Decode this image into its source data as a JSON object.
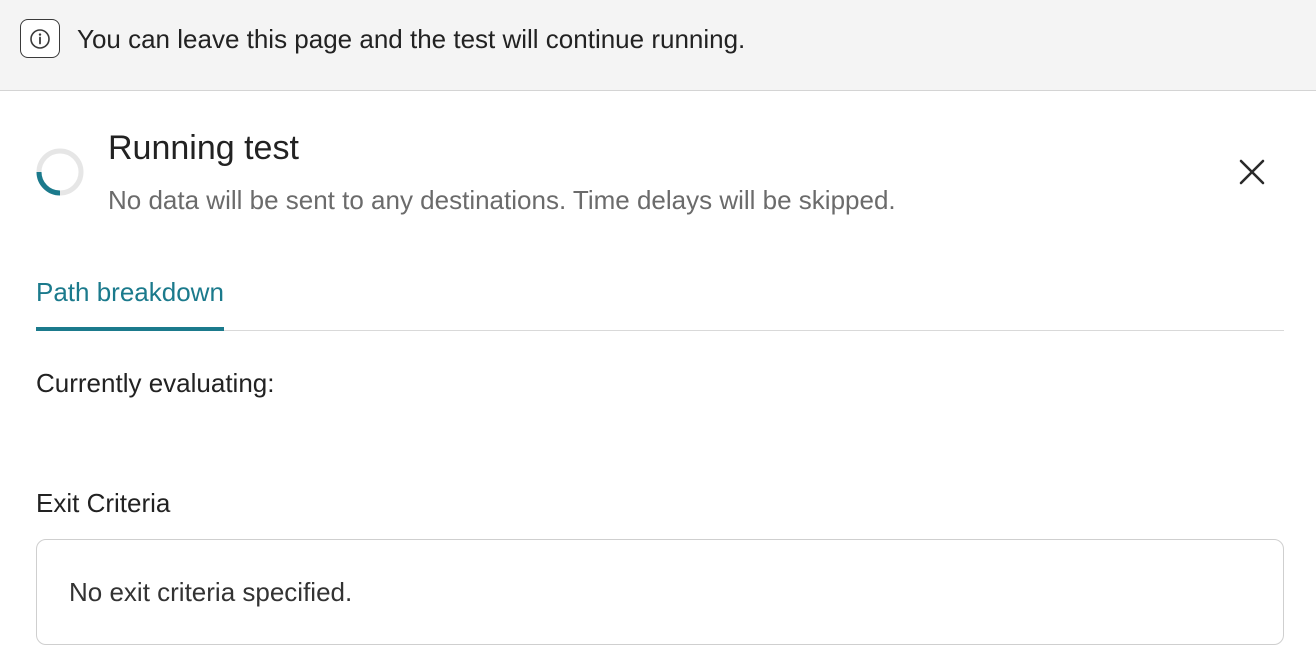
{
  "banner": {
    "icon": "info-icon",
    "text": "You can leave this page and the test will continue running."
  },
  "header": {
    "status_icon": "loading-spinner-icon",
    "title": "Running test",
    "subtitle": "No data will be sent to any destinations. Time delays will be skipped.",
    "close_icon": "close-icon"
  },
  "tabs": [
    {
      "label": "Path breakdown",
      "active": true
    }
  ],
  "main": {
    "currently_evaluating_label": "Currently evaluating:",
    "exit_criteria_label": "Exit Criteria",
    "exit_criteria_text": "No exit criteria specified."
  },
  "colors": {
    "accent": "#1b7a8c",
    "banner_bg": "#f4f4f4",
    "text": "#222222",
    "muted_text": "#6b6b6b",
    "border": "#cfcfcf"
  }
}
